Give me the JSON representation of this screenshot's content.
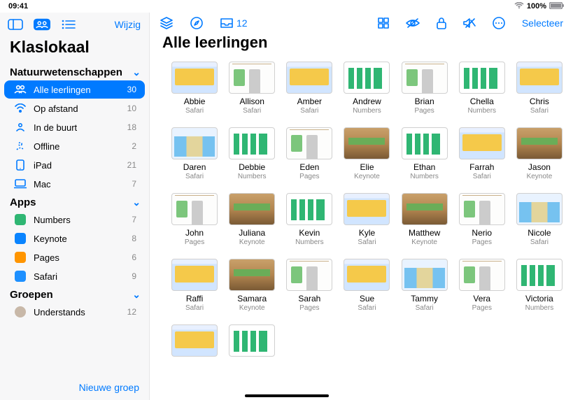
{
  "status": {
    "time": "09:41",
    "wifi": "wifi",
    "battery": "100%"
  },
  "sidebar": {
    "edit": "Wijzig",
    "title": "Klaslokaal",
    "class_name": "Natuurwetenschappen",
    "filters": [
      {
        "label": "Alle leerlingen",
        "count": 30,
        "icon": "people",
        "selected": true
      },
      {
        "label": "Op afstand",
        "count": 10,
        "icon": "remote"
      },
      {
        "label": "In de buurt",
        "count": 18,
        "icon": "nearby"
      },
      {
        "label": "Offline",
        "count": 2,
        "icon": "offline"
      },
      {
        "label": "iPad",
        "count": 21,
        "icon": "ipad"
      },
      {
        "label": "Mac",
        "count": 7,
        "icon": "mac"
      }
    ],
    "apps_title": "Apps",
    "apps": [
      {
        "label": "Numbers",
        "count": 7,
        "color": "#2fb673"
      },
      {
        "label": "Keynote",
        "count": 8,
        "color": "#0a84ff"
      },
      {
        "label": "Pages",
        "count": 6,
        "color": "#ff9500"
      },
      {
        "label": "Safari",
        "count": 9,
        "color": "#1e90ff"
      }
    ],
    "groups_title": "Groepen",
    "groups": [
      {
        "label": "Understands",
        "count": 12
      }
    ],
    "new_group": "Nieuwe groep"
  },
  "toolbar": {
    "inbox_count": "12",
    "select": "Selecteer"
  },
  "main": {
    "title": "Alle leerlingen",
    "students": [
      {
        "name": "Abbie",
        "app": "Safari",
        "thumb": "t-safari"
      },
      {
        "name": "Allison",
        "app": "Safari",
        "thumb": "t-pages"
      },
      {
        "name": "Amber",
        "app": "Safari",
        "thumb": "t-safari"
      },
      {
        "name": "Andrew",
        "app": "Numbers",
        "thumb": "t-numbers"
      },
      {
        "name": "Brian",
        "app": "Pages",
        "thumb": "t-pages"
      },
      {
        "name": "Chella",
        "app": "Numbers",
        "thumb": "t-numbers"
      },
      {
        "name": "Chris",
        "app": "Safari",
        "thumb": "t-safari"
      },
      {
        "name": "Daren",
        "app": "Safari",
        "thumb": "t-safari2"
      },
      {
        "name": "Debbie",
        "app": "Numbers",
        "thumb": "t-numbers"
      },
      {
        "name": "Eden",
        "app": "Pages",
        "thumb": "t-pages"
      },
      {
        "name": "Elie",
        "app": "Keynote",
        "thumb": "t-keynote"
      },
      {
        "name": "Ethan",
        "app": "Numbers",
        "thumb": "t-numbers"
      },
      {
        "name": "Farrah",
        "app": "Safari",
        "thumb": "t-safari"
      },
      {
        "name": "Jason",
        "app": "Keynote",
        "thumb": "t-keynote"
      },
      {
        "name": "John",
        "app": "Pages",
        "thumb": "t-pages"
      },
      {
        "name": "Juliana",
        "app": "Keynote",
        "thumb": "t-keynote"
      },
      {
        "name": "Kevin",
        "app": "Numbers",
        "thumb": "t-numbers"
      },
      {
        "name": "Kyle",
        "app": "Safari",
        "thumb": "t-safari"
      },
      {
        "name": "Matthew",
        "app": "Keynote",
        "thumb": "t-keynote"
      },
      {
        "name": "Nerio",
        "app": "Pages",
        "thumb": "t-pages"
      },
      {
        "name": "Nicole",
        "app": "Safari",
        "thumb": "t-safari2"
      },
      {
        "name": "Raffi",
        "app": "Safari",
        "thumb": "t-safari"
      },
      {
        "name": "Samara",
        "app": "Keynote",
        "thumb": "t-keynote"
      },
      {
        "name": "Sarah",
        "app": "Pages",
        "thumb": "t-pages"
      },
      {
        "name": "Sue",
        "app": "Safari",
        "thumb": "t-safari"
      },
      {
        "name": "Tammy",
        "app": "Safari",
        "thumb": "t-safari2"
      },
      {
        "name": "Vera",
        "app": "Pages",
        "thumb": "t-pages"
      },
      {
        "name": "Victoria",
        "app": "Numbers",
        "thumb": "t-numbers"
      },
      {
        "name": "",
        "app": "",
        "thumb": "t-safari"
      },
      {
        "name": "",
        "app": "",
        "thumb": "t-numbers"
      }
    ]
  }
}
